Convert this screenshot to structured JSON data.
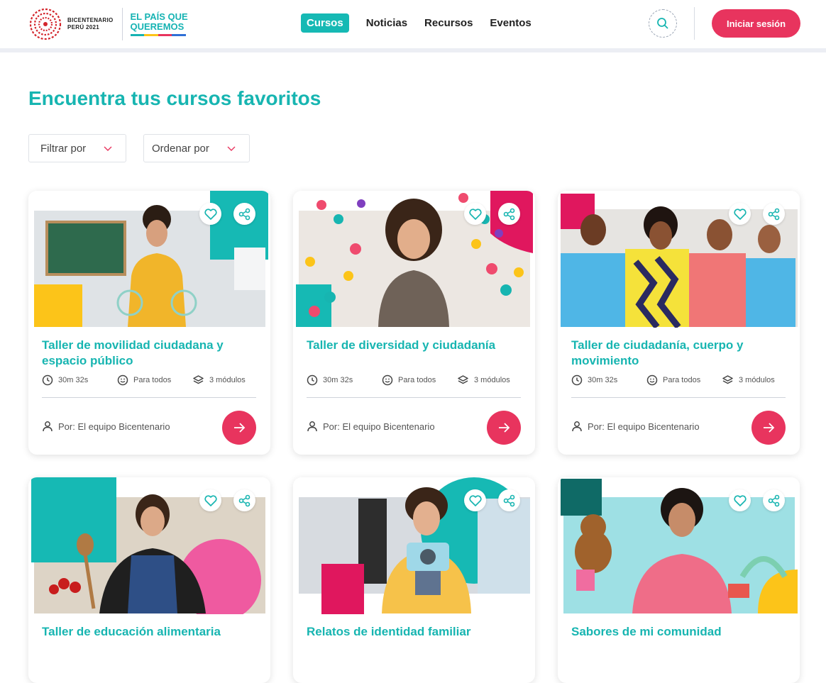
{
  "header": {
    "logo_line1": "BICENTENARIO",
    "logo_line2": "PERÚ 2021",
    "tagline_line1": "EL PAÍS QUE",
    "tagline_line2": "QUEREMOS",
    "nav": [
      {
        "label": "Cursos",
        "active": true
      },
      {
        "label": "Noticias",
        "active": false
      },
      {
        "label": "Recursos",
        "active": false
      },
      {
        "label": "Eventos",
        "active": false
      }
    ],
    "login_label": "Iniciar sesión",
    "icons": {
      "search": "search-icon"
    }
  },
  "main": {
    "title": "Encuentra tus cursos favoritos",
    "filter_label": "Filtrar por",
    "sort_label": "Ordenar por"
  },
  "colors": {
    "teal": "#17b5b1",
    "pink": "#e8345e",
    "yellow": "#fcc419"
  },
  "courses": [
    {
      "title": "Taller de movilidad ciudadana y espacio público",
      "duration": "30m 32s",
      "audience": "Para todos",
      "modules": "3 módulos",
      "author": "Por: El equipo Bicentenario"
    },
    {
      "title": "Taller de diversidad y ciudadanía",
      "duration": "30m 32s",
      "audience": "Para todos",
      "modules": "3 módulos",
      "author": "Por: El equipo Bicentenario"
    },
    {
      "title": "Taller de ciudadanía, cuerpo y movimiento",
      "duration": "30m 32s",
      "audience": "Para todos",
      "modules": "3 módulos",
      "author": "Por: El equipo Bicentenario"
    },
    {
      "title": "Taller de educación alimentaria"
    },
    {
      "title": "Relatos de identidad familiar"
    },
    {
      "title": "Sabores de mi comunidad"
    }
  ]
}
